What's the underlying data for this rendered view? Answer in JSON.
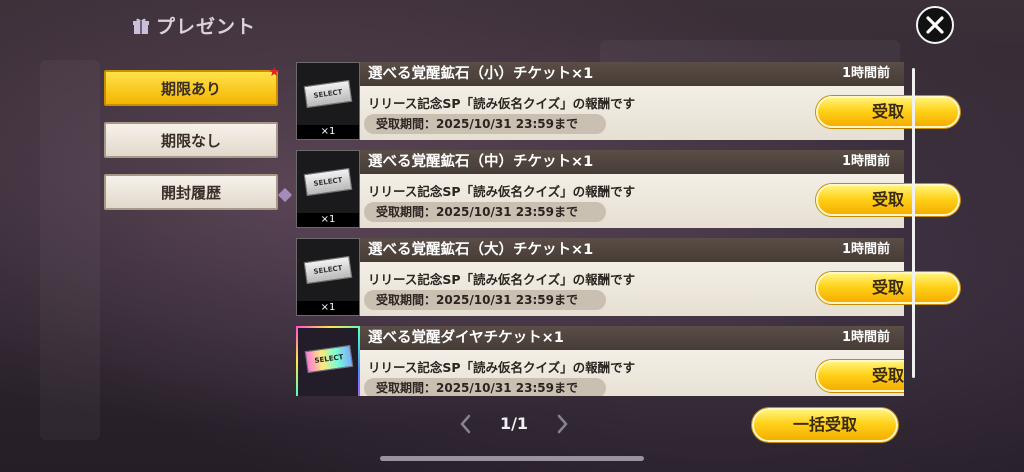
{
  "header": {
    "title": "プレゼント",
    "icon": "gift-icon"
  },
  "tabs": [
    {
      "label": "期限あり",
      "active": true,
      "badge": "★"
    },
    {
      "label": "期限なし",
      "active": false
    },
    {
      "label": "開封履歴",
      "active": false
    }
  ],
  "items": [
    {
      "name": "選べる覚醒鉱石（小）チケット×1",
      "time": "1時間前",
      "desc": "リリース記念SP「読み仮名クイズ」の報酬です",
      "period": "受取期間：2025/10/31 23:59まで",
      "qty": "×1",
      "ticket": "SELECT",
      "button": "受取"
    },
    {
      "name": "選べる覚醒鉱石（中）チケット×1",
      "time": "1時間前",
      "desc": "リリース記念SP「読み仮名クイズ」の報酬です",
      "period": "受取期間：2025/10/31 23:59まで",
      "qty": "×1",
      "ticket": "SELECT",
      "button": "受取"
    },
    {
      "name": "選べる覚醒鉱石（大）チケット×1",
      "time": "1時間前",
      "desc": "リリース記念SP「読み仮名クイズ」の報酬です",
      "period": "受取期間：2025/10/31 23:59まで",
      "qty": "×1",
      "ticket": "SELECT",
      "button": "受取"
    },
    {
      "name": "選べる覚醒ダイヤチケット×1",
      "time": "1時間前",
      "desc": "リリース記念SP「読み仮名クイズ」の報酬です",
      "period": "受取期間：2025/10/31 23:59まで",
      "qty": "",
      "ticket": "SELECT",
      "button": "受取"
    }
  ],
  "pager": {
    "page": "1/1"
  },
  "bulk_button": "一括受取",
  "colors": {
    "accent": "#ffd21a",
    "tab_active": "#f5b500",
    "namebar": "#4f443d",
    "body": "#ede7dc"
  }
}
